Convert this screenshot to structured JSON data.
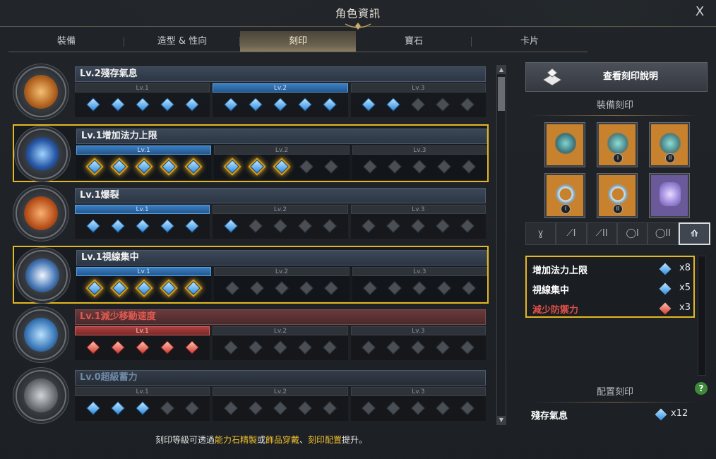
{
  "window": {
    "title": "角色資訊",
    "close_label": "X"
  },
  "tabs": [
    {
      "label": "裝備",
      "active": false
    },
    {
      "label": "造型 & 性向",
      "active": false
    },
    {
      "label": "刻印",
      "active": true
    },
    {
      "label": "寶石",
      "active": false
    },
    {
      "label": "卡片",
      "active": false
    }
  ],
  "level_labels": [
    "Lv.1",
    "Lv.2",
    "Lv.3"
  ],
  "engravings": [
    {
      "name": "Lv.2殘存氣息",
      "style": "normal",
      "active_level": 2,
      "gems": [
        "b",
        "b",
        "b",
        "b",
        "b",
        "b",
        "b",
        "b",
        "b",
        "b",
        "b",
        "b",
        "g",
        "g",
        "g"
      ],
      "selected": false
    },
    {
      "name": "Lv.1增加法力上限",
      "style": "normal",
      "active_level": 1,
      "gems": [
        "b",
        "b",
        "b",
        "b",
        "b",
        "b",
        "b",
        "b",
        "g",
        "g",
        "g",
        "g",
        "g",
        "g",
        "g"
      ],
      "selected": true
    },
    {
      "name": "Lv.1爆裂",
      "style": "normal",
      "active_level": 1,
      "gems": [
        "b",
        "b",
        "b",
        "b",
        "b",
        "b",
        "g",
        "g",
        "g",
        "g",
        "g",
        "g",
        "g",
        "g",
        "g"
      ],
      "selected": false
    },
    {
      "name": "Lv.1視線集中",
      "style": "normal",
      "active_level": 1,
      "gems": [
        "b",
        "b",
        "b",
        "b",
        "b",
        "g",
        "g",
        "g",
        "g",
        "g",
        "g",
        "g",
        "g",
        "g",
        "g"
      ],
      "selected": true
    },
    {
      "name": "Lv.1減少移動速度",
      "style": "negative",
      "active_level": 1,
      "gems": [
        "r",
        "r",
        "r",
        "r",
        "r",
        "g",
        "g",
        "g",
        "g",
        "g",
        "g",
        "g",
        "g",
        "g",
        "g"
      ],
      "selected": false
    },
    {
      "name": "Lv.0超級蓄力",
      "style": "dim",
      "active_level": 0,
      "gems": [
        "b",
        "b",
        "b",
        "g",
        "g",
        "g",
        "g",
        "g",
        "g",
        "g",
        "g",
        "g",
        "g",
        "g",
        "g"
      ],
      "selected": false
    }
  ],
  "footer": {
    "p1": "刻印等級可透過",
    "h1": "能力石精製",
    "p2": "或",
    "h2": "飾品穿戴",
    "p3": "、",
    "h3": "刻印配置",
    "p4": "提升。"
  },
  "right_panel": {
    "guide_button": "查看刻印說明",
    "equipped_heading": "裝備刻印",
    "slot_numerals": [
      "I",
      "II",
      "I",
      "II"
    ],
    "icon_bar": [
      "necklace-icon",
      "earring1-icon",
      "earring2-icon",
      "ring1-icon",
      "ring2-icon",
      "stone-icon"
    ],
    "icon_bar_labels": [
      "ɣ",
      "⟋I",
      "⟋II",
      "◯I",
      "◯II",
      "⟰"
    ],
    "effects": [
      {
        "name": "增加法力上限",
        "gem": "blue",
        "count": "x8",
        "negative": false
      },
      {
        "name": "視線集中",
        "gem": "blue",
        "count": "x5",
        "negative": false
      },
      {
        "name": "減少防禦力",
        "gem": "red",
        "count": "x3",
        "negative": true
      }
    ],
    "placed_heading": "配置刻印",
    "placed": {
      "name": "殘存氣息",
      "count": "x12"
    },
    "help_label": "?"
  },
  "colors": {
    "accent": "#e4b820",
    "blue_gem": "#2f8be0",
    "red_gem": "#d03a30",
    "highlight_text": "#f0c030"
  }
}
